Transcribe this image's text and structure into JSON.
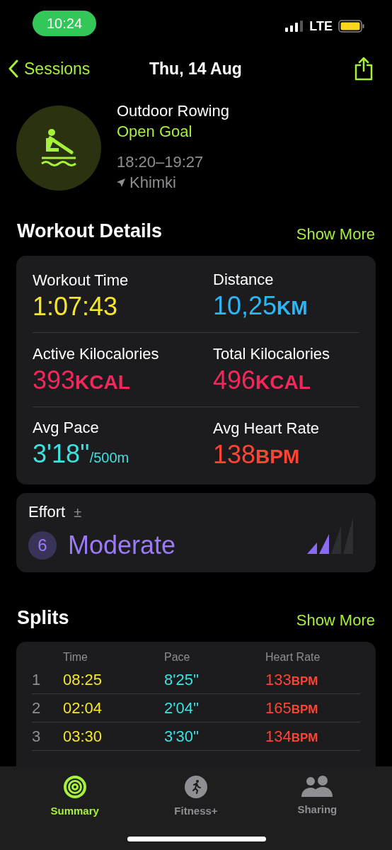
{
  "status_bar": {
    "time": "10:24",
    "network": "LTE"
  },
  "nav": {
    "back_label": "Sessions",
    "title": "Thu, 14 Aug"
  },
  "workout": {
    "name": "Outdoor Rowing",
    "goal": "Open Goal",
    "time_range": "18:20–19:27",
    "location": "Khimki"
  },
  "details": {
    "title": "Workout Details",
    "action": "Show More",
    "metrics": [
      {
        "label": "Workout Time",
        "value": "1:07:43",
        "color": "#f5e52b"
      },
      {
        "label": "Distance",
        "value": "10,25",
        "unit": "KM",
        "color": "#2cb6f5"
      },
      {
        "label": "Active Kilocalories",
        "value": "393",
        "unit": "KCAL",
        "color": "#f2285c"
      },
      {
        "label": "Total Kilocalories",
        "value": "496",
        "unit": "KCAL",
        "color": "#f2285c"
      },
      {
        "label": "Avg Pace",
        "value": "3'18''",
        "unit": "/500m",
        "color": "#3fe0e0"
      },
      {
        "label": "Avg Heart Rate",
        "value": "138",
        "unit": "BPM",
        "color": "#ff4433"
      }
    ]
  },
  "effort": {
    "label": "Effort",
    "adjust": "±",
    "score": "6",
    "rating": "Moderate",
    "level": 0.5
  },
  "splits": {
    "title": "Splits",
    "action": "Show More",
    "columns": [
      "Time",
      "Pace",
      "Heart Rate"
    ],
    "rows": [
      {
        "index": "1",
        "time": "08:25",
        "pace": "8'25''",
        "heart_rate": "133",
        "unit": "BPM"
      },
      {
        "index": "2",
        "time": "02:04",
        "pace": "2'04''",
        "heart_rate": "165",
        "unit": "BPM"
      },
      {
        "index": "3",
        "time": "03:30",
        "pace": "3'30''",
        "heart_rate": "134",
        "unit": "BPM"
      }
    ]
  },
  "tab_bar": [
    {
      "label": "Summary",
      "selected": true
    },
    {
      "label": "Fitness+",
      "selected": false
    },
    {
      "label": "Sharing",
      "selected": false
    }
  ]
}
